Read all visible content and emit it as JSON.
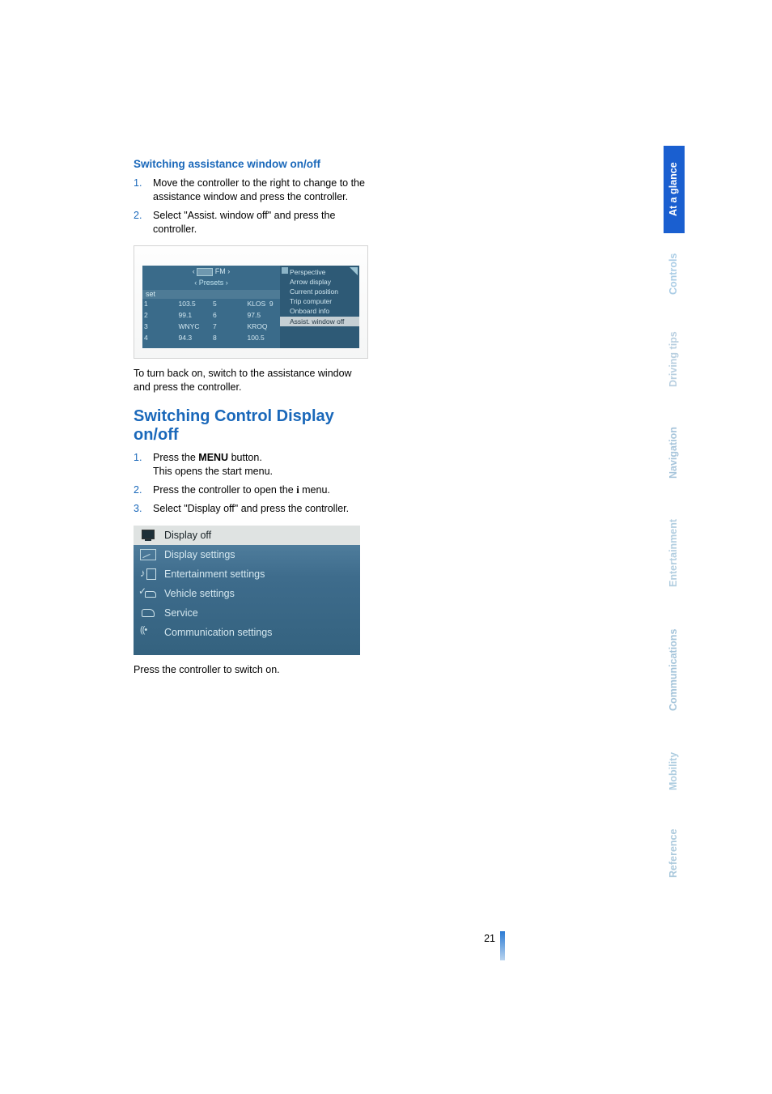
{
  "page_number": "21",
  "section1": {
    "heading": "Switching assistance window on/off",
    "steps": [
      "Move the controller to the right to change to the assistance window and press the controller.",
      "Select \"Assist. window off\" and press the controller."
    ],
    "screenshot": {
      "top_band": "FM",
      "presets_label": "‹ Presets ›",
      "set_label": "set",
      "cells": [
        [
          "1",
          "103.5",
          "5",
          "KLOS",
          "9",
          ""
        ],
        [
          "2",
          "99.1",
          "6",
          "97.5",
          "",
          ""
        ],
        [
          "3",
          "WNYC",
          "7",
          "KROQ",
          "",
          ""
        ],
        [
          "4",
          "94.3",
          "8",
          "100.5",
          "",
          ""
        ]
      ],
      "right_items": [
        "Perspective",
        "Arrow display",
        "Current position",
        "Trip computer",
        "Onboard info",
        "Assist. window off"
      ],
      "right_selected_index": 5
    },
    "after_text": "To turn back on, switch to the assistance window and press the controller."
  },
  "section2": {
    "heading": "Switching Control Display on/off",
    "steps": [
      {
        "pre": "Press the ",
        "bold": "MENU",
        "post": " button.",
        "line2": "This opens the start menu."
      },
      {
        "pre": "Press the controller to open the ",
        "icon": "i",
        "post": " menu."
      },
      {
        "pre": "Select \"Display off\" and press the controller."
      }
    ],
    "menu": {
      "items": [
        {
          "icon": "monitor",
          "label": "Display off",
          "selected": true
        },
        {
          "icon": "disp",
          "label": "Display settings"
        },
        {
          "icon": "note",
          "label": "Entertainment settings"
        },
        {
          "icon": "car",
          "label": "Vehicle settings"
        },
        {
          "icon": "serv",
          "label": "Service"
        },
        {
          "icon": "comm",
          "label": "Communication settings"
        }
      ]
    },
    "after_text": "Press the controller to switch on."
  },
  "tabs": [
    {
      "label": "At a glance",
      "active": true
    },
    {
      "label": "Controls"
    },
    {
      "label": "Driving tips"
    },
    {
      "label": "Navigation"
    },
    {
      "label": "Entertainment"
    },
    {
      "label": "Communications"
    },
    {
      "label": "Mobility"
    },
    {
      "label": "Reference"
    }
  ]
}
